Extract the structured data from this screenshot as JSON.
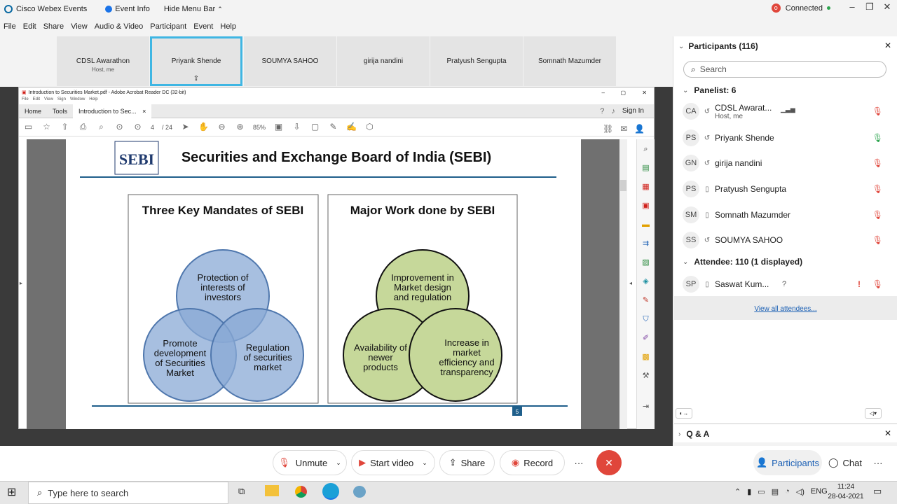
{
  "titlebar": {
    "app_name": "Cisco Webex Events",
    "event_info": "Event Info",
    "hide_menu": "Hide Menu Bar",
    "status": "Connected"
  },
  "menu": [
    "File",
    "Edit",
    "Share",
    "View",
    "Audio & Video",
    "Participant",
    "Event",
    "Help"
  ],
  "tiles": [
    {
      "name": "CDSL Awarathon",
      "sub": "Host, me"
    },
    {
      "name": "Priyank Shende",
      "sub": ""
    },
    {
      "name": "SOUMYA SAHOO",
      "sub": ""
    },
    {
      "name": "girija nandini",
      "sub": ""
    },
    {
      "name": "Pratyush Sengupta",
      "sub": ""
    },
    {
      "name": "Somnath Mazumder",
      "sub": ""
    }
  ],
  "acrobat": {
    "window_title": "Introduction to Securities Market.pdf - Adobe Acrobat Reader DC (32-bit)",
    "menu": [
      "File",
      "Edit",
      "View",
      "Sign",
      "Window",
      "Help"
    ],
    "tabs": [
      "Home",
      "Tools",
      "Introduction to Sec..."
    ],
    "sign_in": "Sign In",
    "page_current": "4",
    "page_total": "/ 24",
    "zoom": "85%"
  },
  "slide": {
    "logo_text": "SEBI",
    "title": "Securities and Exchange Board of India (SEBI)",
    "left_heading": "Three Key Mandates of SEBI",
    "left_circles": [
      "Protection of|interests of|investors",
      "Promote|development|of Securities|Market",
      "Regulation|of securities|market"
    ],
    "right_heading": "Major Work done by SEBI",
    "right_circles": [
      "Improvement  in|Market design|and regulation",
      "Availability of|newer|products",
      "Increase in|market|efficiency and|transparency"
    ],
    "page_number": "5"
  },
  "panel": {
    "title": "Participants (116)",
    "search_placeholder": "Search",
    "panelist_header": "Panelist: 6",
    "panelists": [
      {
        "initials": "CA",
        "name": "CDSL Awarat...",
        "sub": "Host, me"
      },
      {
        "initials": "PS",
        "name": "Priyank Shende",
        "sub": ""
      },
      {
        "initials": "GN",
        "name": "girija nandini",
        "sub": ""
      },
      {
        "initials": "PS",
        "name": "Pratyush Sengupta",
        "sub": ""
      },
      {
        "initials": "SM",
        "name": "Somnath Mazumder",
        "sub": ""
      },
      {
        "initials": "SS",
        "name": "SOUMYA SAHOO",
        "sub": ""
      }
    ],
    "attendee_header": "Attendee: 110 (1 displayed)",
    "attendees": [
      {
        "initials": "SP",
        "name": "Saswat Kum...",
        "mark": "?"
      }
    ],
    "view_all": "View all attendees...",
    "qa_label": "Q & A"
  },
  "controls": {
    "unmute": "Unmute",
    "start_video": "Start video",
    "share": "Share",
    "record": "Record",
    "more": "···",
    "participants": "Participants",
    "chat": "Chat"
  },
  "taskbar": {
    "search_placeholder": "Type here to search",
    "lang": "ENG",
    "time": "11:24",
    "date": "28-04-2021"
  },
  "colors": {
    "accent": "#1a73e8",
    "tile_active_border": "#3fb6e3",
    "end_call": "#e0463b",
    "blue_circle": "#8aa9d6",
    "green_circle": "#c6d89a",
    "slide_rule": "#1f5f8b"
  }
}
